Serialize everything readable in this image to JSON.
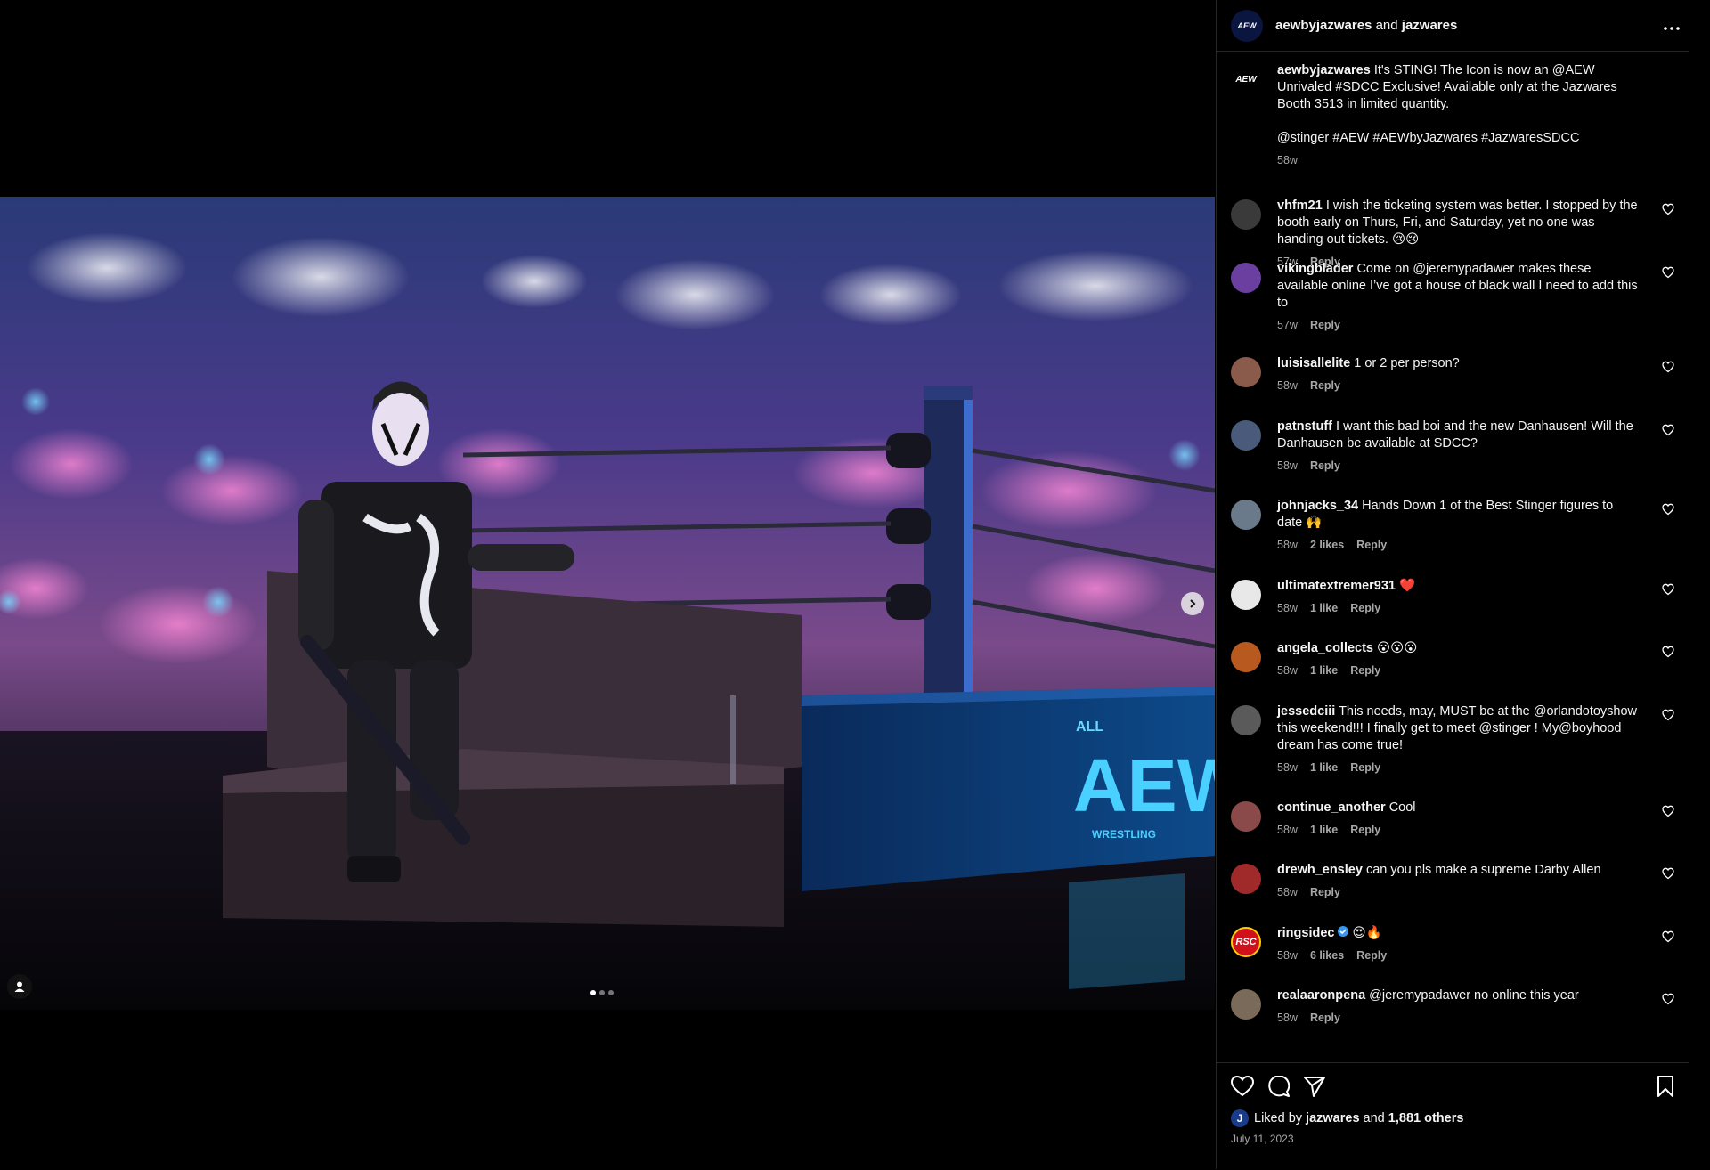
{
  "header": {
    "user1": "aewbyjazwares",
    "and_text": "and",
    "user2": "jazwares",
    "more_icon": "more-horizontal-icon"
  },
  "caption": {
    "user": "aewbyjazwares",
    "avatar_text": "AEW",
    "text": "It's STING! The Icon is now an @AEW Unrivaled #SDCC Exclusive! Available only at the Jazwares Booth 3513 in limited quantity.",
    "tags": "@stinger #AEW #AEWbyJazwares #JazwaresSDCC",
    "time": "58w"
  },
  "comments": [
    {
      "user": "vhfm21",
      "text": "I wish the ticketing system was better. I stopped by the booth early on Thurs, Fri, and Saturday, yet no one was handing out tickets. 😢😢",
      "time": "57w",
      "likes": "",
      "reply": "Reply",
      "color": "#3a3a3a"
    },
    {
      "user": "vikingblader",
      "text": "Come on @jeremypadawer makes these available online I’ve got a house of black wall I need to add this to",
      "time": "57w",
      "likes": "",
      "reply": "Reply",
      "color": "#6b3fa0"
    },
    {
      "user": "luisisallelite",
      "text": "1 or 2 per person?",
      "time": "58w",
      "likes": "",
      "reply": "Reply",
      "color": "#8a5a4a"
    },
    {
      "user": "patnstuff",
      "text": "I want this bad boi and the new Danhausen! Will the Danhausen be available at SDCC?",
      "time": "58w",
      "likes": "",
      "reply": "Reply",
      "color": "#4a5a7a"
    },
    {
      "user": "johnjacks_34",
      "text": "Hands Down 1 of the Best Stinger figures to date 🙌",
      "time": "58w",
      "likes": "2 likes",
      "reply": "Reply",
      "color": "#6a7a8a"
    },
    {
      "user": "ultimatextremer931",
      "text": "❤️",
      "time": "58w",
      "likes": "1 like",
      "reply": "Reply",
      "color": "#e8e8e8"
    },
    {
      "user": "angela_collects",
      "text": "😮😮😮",
      "time": "58w",
      "likes": "1 like",
      "reply": "Reply",
      "color": "#b85a20"
    },
    {
      "user": "jessedciii",
      "text": "This needs, may, MUST be at the @orlandotoyshow this weekend!!! I finally get to meet @stinger ! My@boyhood dream has come true!",
      "time": "58w",
      "likes": "1 like",
      "reply": "Reply",
      "color": "#5a5a5a"
    },
    {
      "user": "continue_another",
      "text": "Cool",
      "time": "58w",
      "likes": "1 like",
      "reply": "Reply",
      "color": "#8a4a4a"
    },
    {
      "user": "drewh_ensley",
      "text": "can you pls make a supreme Darby Allen",
      "time": "58w",
      "likes": "",
      "reply": "Reply",
      "color": "#a02a2a"
    },
    {
      "user": "ringsidec",
      "text": "😍🔥",
      "time": "58w",
      "likes": "6 likes",
      "reply": "Reply",
      "color": "#d0101a",
      "avatar_text": "RSC",
      "verified": true
    },
    {
      "user": "realaaronpena",
      "text": "@jeremypadawer no online this year",
      "time": "58w",
      "likes": "",
      "reply": "Reply",
      "color": "#7a6a5a"
    }
  ],
  "actions": {
    "liked_by_prefix": "Liked by",
    "liked_user": "jazwares",
    "and_text": "and",
    "others": "1,881 others",
    "liked_avatar_text": "J",
    "date": "July 11, 2023"
  },
  "photo": {
    "ring_text_top": "ALL",
    "ring_logo": "AEW",
    "ring_text_bottom": "WRESTLING"
  }
}
